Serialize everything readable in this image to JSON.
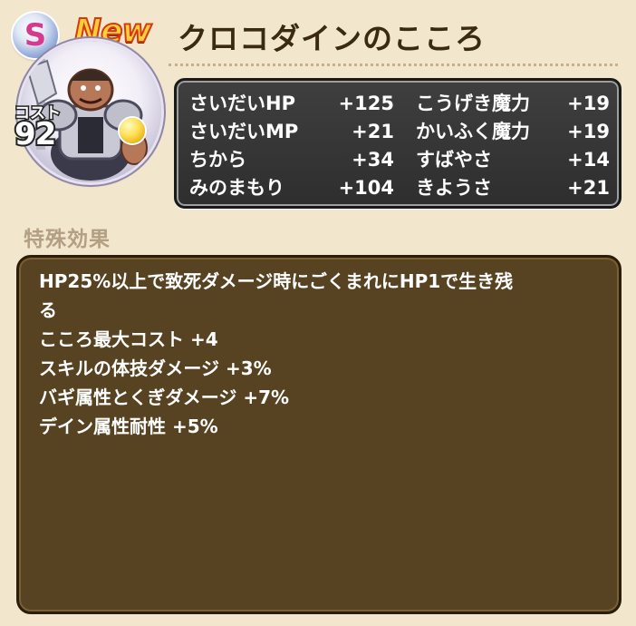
{
  "header": {
    "rank": "S",
    "new_badge": "New",
    "title": "クロコダインのこころ"
  },
  "card": {
    "cost_label": "コスト",
    "cost_value": "92",
    "portrait_icon": "crocodine-portrait-icon",
    "type_icon": "yellow-orb-icon"
  },
  "stats": [
    {
      "label": "さいだいHP",
      "value": "+125"
    },
    {
      "label": "こうげき魔力",
      "value": "+19"
    },
    {
      "label": "さいだいMP",
      "value": "+21"
    },
    {
      "label": "かいふく魔力",
      "value": "+19"
    },
    {
      "label": "ちから",
      "value": "+34"
    },
    {
      "label": "すばやさ",
      "value": "+14"
    },
    {
      "label": "みのまもり",
      "value": "+104"
    },
    {
      "label": "きようさ",
      "value": "+21"
    }
  ],
  "special": {
    "heading": "特殊効果",
    "effects": [
      "HP25%以上で致死ダメージ時にごくまれにHP1で生き残",
      "る",
      "こころ最大コスト +4",
      "スキルの体技ダメージ +3%",
      "バギ属性とくぎダメージ +7%",
      "デイン属性耐性 +5%"
    ]
  },
  "colors": {
    "background": "#f2e6cc",
    "stats_panel": "#333333",
    "effects_panel": "#574321",
    "title_text": "#3b2a12",
    "heading_text": "#b39f83"
  }
}
